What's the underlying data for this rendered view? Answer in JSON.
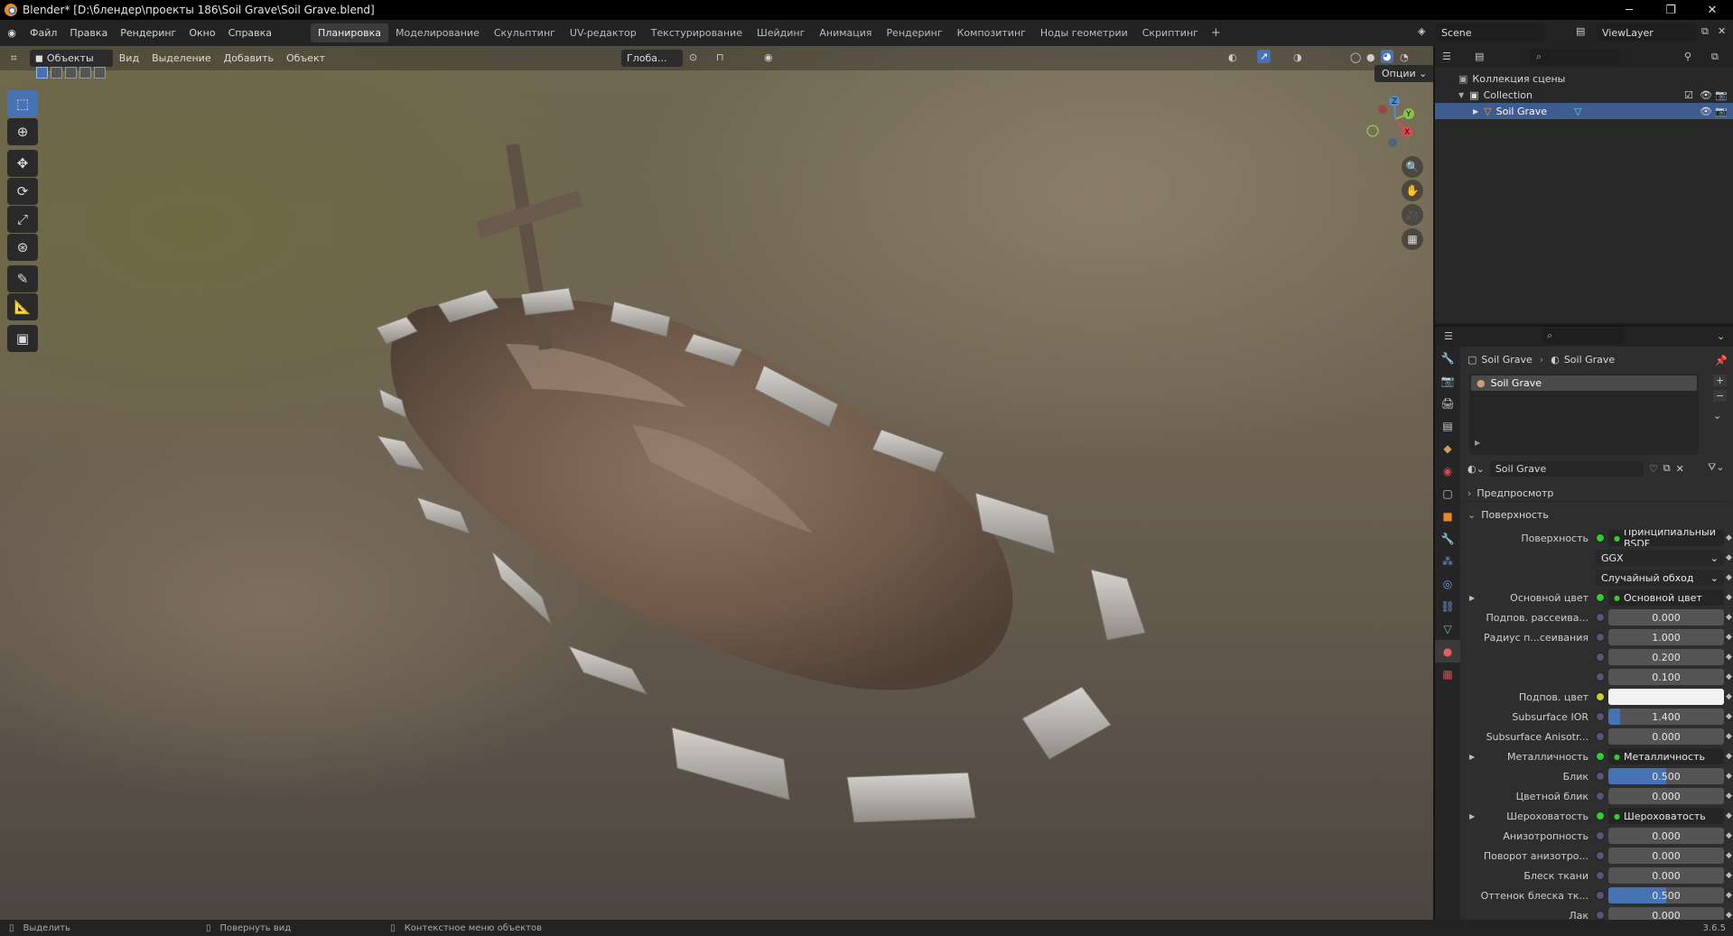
{
  "window": {
    "title": "Blender* [D:\\блендер\\проекты 186\\Soil Grave\\Soil Grave.blend]"
  },
  "menu": [
    "Файл",
    "Правка",
    "Рендеринг",
    "Окно",
    "Справка"
  ],
  "workspaces": [
    "Планировка",
    "Моделирование",
    "Скульптинг",
    "UV-редактор",
    "Текстурирование",
    "Шейдинг",
    "Анимация",
    "Рендеринг",
    "Композитинг",
    "Ноды геометрии",
    "Скриптинг"
  ],
  "scene": "Scene",
  "view_layer": "ViewLayer",
  "viewport": {
    "mode": "Объекты",
    "menus": [
      "Вид",
      "Выделение",
      "Добавить",
      "Объект"
    ],
    "orientation": "Глоба...",
    "options": "Опции",
    "gizmo": {
      "x": "X",
      "y": "Y",
      "z": "Z"
    }
  },
  "outliner": {
    "root": "Коллекция сцены",
    "collection": "Collection",
    "object": "Soil Grave"
  },
  "properties": {
    "breadcrumb": [
      "Soil Grave",
      "Soil Grave"
    ],
    "slot": "Soil Grave",
    "material": "Soil Grave",
    "sections": {
      "preview": "Предпросмотр",
      "surface": "Поверхность"
    },
    "rows": [
      {
        "label": "Поверхность",
        "value": "Принципиальный BSDF",
        "kind": "link"
      },
      {
        "label": "",
        "value": "GGX",
        "kind": "dd"
      },
      {
        "label": "",
        "value": "Случайный обход",
        "kind": "dd"
      },
      {
        "label": "Основной цвет",
        "value": "Основной цвет",
        "kind": "link",
        "expand": true
      },
      {
        "label": "Подпов. рассеива...",
        "value": "0.000",
        "kind": "num"
      },
      {
        "label": "Радиус п...сеивания",
        "value": "1.000",
        "kind": "num"
      },
      {
        "label": "",
        "value": "0.200",
        "kind": "num"
      },
      {
        "label": "",
        "value": "0.100",
        "kind": "num"
      },
      {
        "label": "Подпов. цвет",
        "value": "",
        "kind": "color"
      },
      {
        "label": "Subsurface IOR",
        "value": "1.400",
        "kind": "num",
        "fill": 0.1
      },
      {
        "label": "Subsurface Anisotr...",
        "value": "0.000",
        "kind": "num"
      },
      {
        "label": "Металличность",
        "value": "Металличность",
        "kind": "link",
        "expand": true
      },
      {
        "label": "Блик",
        "value": "0.500",
        "kind": "num",
        "fill": 0.5
      },
      {
        "label": "Цветной блик",
        "value": "0.000",
        "kind": "num"
      },
      {
        "label": "Шероховатость",
        "value": "Шероховатость",
        "kind": "link",
        "expand": true
      },
      {
        "label": "Анизотропность",
        "value": "0.000",
        "kind": "num"
      },
      {
        "label": "Поворот анизотро...",
        "value": "0.000",
        "kind": "num"
      },
      {
        "label": "Блеск ткани",
        "value": "0.000",
        "kind": "num"
      },
      {
        "label": "Оттенок блеска тк...",
        "value": "0.500",
        "kind": "num",
        "fill": 0.5
      },
      {
        "label": "Лак",
        "value": "0.000",
        "kind": "num"
      }
    ]
  },
  "status": {
    "select": "Выделить",
    "rotate": "Повернуть вид",
    "context": "Контекстное меню объектов",
    "version": "3.6.5"
  },
  "colors": {
    "accent": "#4772b3",
    "soil": "#7a6452",
    "stone": "#b9b6b0",
    "wood": "#5e5146"
  }
}
